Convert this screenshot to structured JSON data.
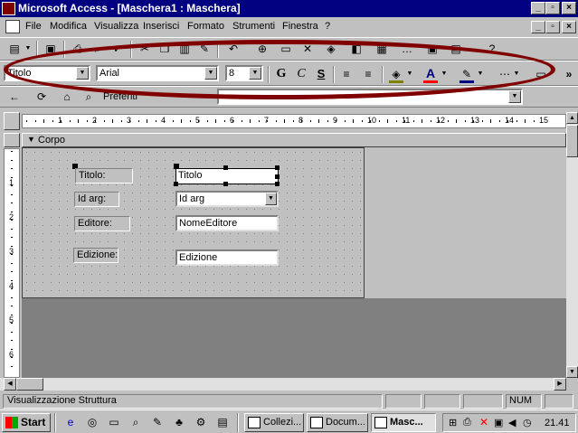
{
  "window": {
    "title": "Microsoft Access - [Maschera1 : Maschera]"
  },
  "menu": [
    "File",
    "Modifica",
    "Visualizza",
    "Inserisci",
    "Formato",
    "Strumenti",
    "Finestra",
    "?"
  ],
  "format_toolbar": {
    "object_combo": "Titolo",
    "font_combo": "Arial",
    "size_combo": "8",
    "bold": "G",
    "italic": "C",
    "underline": "S",
    "font_color_letter": "A"
  },
  "form_toolbar": {
    "label": "Preferiti"
  },
  "ruler_numbers": [
    "1",
    "2",
    "3",
    "4",
    "5",
    "6",
    "7",
    "8",
    "9",
    "10",
    "11",
    "12",
    "13",
    "14",
    "15"
  ],
  "vruler_numbers": [
    "1",
    "2",
    "3",
    "4",
    "5",
    "6"
  ],
  "section": {
    "name": "Corpo"
  },
  "fields": [
    {
      "label": "Titolo:",
      "control": "Titolo",
      "type": "textbox"
    },
    {
      "label": "Id arg:",
      "control": "Id arg",
      "type": "combobox"
    },
    {
      "label": "Editore:",
      "control": "NomeEditore",
      "type": "textbox"
    },
    {
      "label": "Edizione:",
      "control": "Edizione",
      "type": "textbox"
    }
  ],
  "status": {
    "text": "Visualizzazione Struttura",
    "num": "NUM"
  },
  "taskbar": {
    "start": "Start",
    "tasks": [
      "Collezi...",
      "Docum...",
      "Masc..."
    ],
    "clock": "21.41"
  },
  "colors": {
    "title_bg": "#000080",
    "annotation_ellipse": "#800000",
    "desktop_grey": "#808080"
  }
}
